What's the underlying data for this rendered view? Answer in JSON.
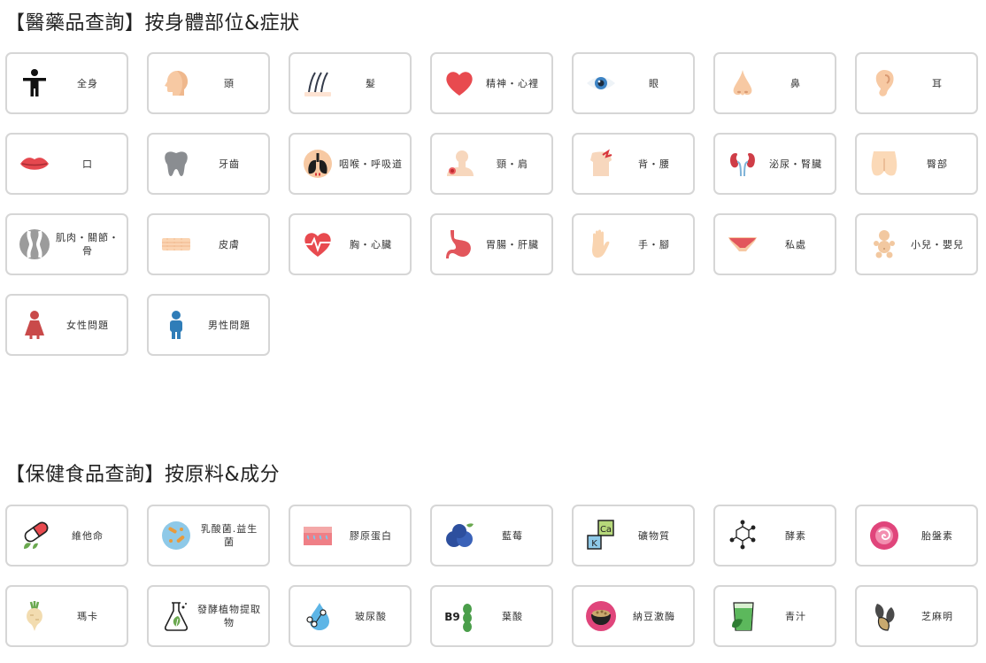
{
  "sections": [
    {
      "title": "【醫藥品查詢】按身體部位&症狀",
      "items": [
        {
          "label": "全身",
          "icon": "human-body-icon"
        },
        {
          "label": "頭",
          "icon": "head-icon"
        },
        {
          "label": "髮",
          "icon": "hair-icon"
        },
        {
          "label": "精神・心裡",
          "icon": "heart-icon"
        },
        {
          "label": "眼",
          "icon": "eye-icon"
        },
        {
          "label": "鼻",
          "icon": "nose-icon"
        },
        {
          "label": "耳",
          "icon": "ear-icon"
        },
        {
          "label": "口",
          "icon": "lips-icon"
        },
        {
          "label": "牙齒",
          "icon": "tooth-icon"
        },
        {
          "label": "咽喉・呼吸道",
          "icon": "throat-lungs-icon"
        },
        {
          "label": "頸・肩",
          "icon": "neck-shoulder-icon"
        },
        {
          "label": "背・腰",
          "icon": "back-icon"
        },
        {
          "label": "泌尿・腎臟",
          "icon": "kidneys-icon"
        },
        {
          "label": "臀部",
          "icon": "buttocks-icon"
        },
        {
          "label": "肌肉・關節・骨",
          "icon": "joint-icon"
        },
        {
          "label": "皮膚",
          "icon": "skin-icon"
        },
        {
          "label": "胸・心臟",
          "icon": "heartbeat-icon"
        },
        {
          "label": "胃腸・肝臟",
          "icon": "stomach-icon"
        },
        {
          "label": "手・腳",
          "icon": "hand-icon"
        },
        {
          "label": "私處",
          "icon": "underwear-icon"
        },
        {
          "label": "小兒・嬰兒",
          "icon": "baby-icon"
        },
        {
          "label": "女性問題",
          "icon": "woman-icon"
        },
        {
          "label": "男性問題",
          "icon": "man-icon"
        }
      ]
    },
    {
      "title": "【保健食品查詢】按原料&成分",
      "items": [
        {
          "label": "維他命",
          "icon": "capsule-icon"
        },
        {
          "label": "乳酸菌.益生菌",
          "icon": "bacteria-icon"
        },
        {
          "label": "膠原蛋白",
          "icon": "collagen-skin-icon"
        },
        {
          "label": "藍莓",
          "icon": "blueberry-icon"
        },
        {
          "label": "礦物質",
          "icon": "minerals-icon"
        },
        {
          "label": "酵素",
          "icon": "molecule-icon"
        },
        {
          "label": "胎盤素",
          "icon": "placenta-icon"
        },
        {
          "label": "瑪卡",
          "icon": "maca-root-icon"
        },
        {
          "label": "發酵植物提取物",
          "icon": "flask-leaf-icon"
        },
        {
          "label": "玻尿酸",
          "icon": "water-drop-icon"
        },
        {
          "label": "葉酸",
          "icon": "b9-icon",
          "badge": "B9"
        },
        {
          "label": "納豆激酶",
          "icon": "natto-bowl-icon"
        },
        {
          "label": "青汁",
          "icon": "green-juice-icon"
        },
        {
          "label": "芝麻明",
          "icon": "sesame-icon"
        }
      ]
    }
  ],
  "colors": {
    "border": "#d6d6d6",
    "text": "#333333",
    "heart": "#e84a4f"
  }
}
